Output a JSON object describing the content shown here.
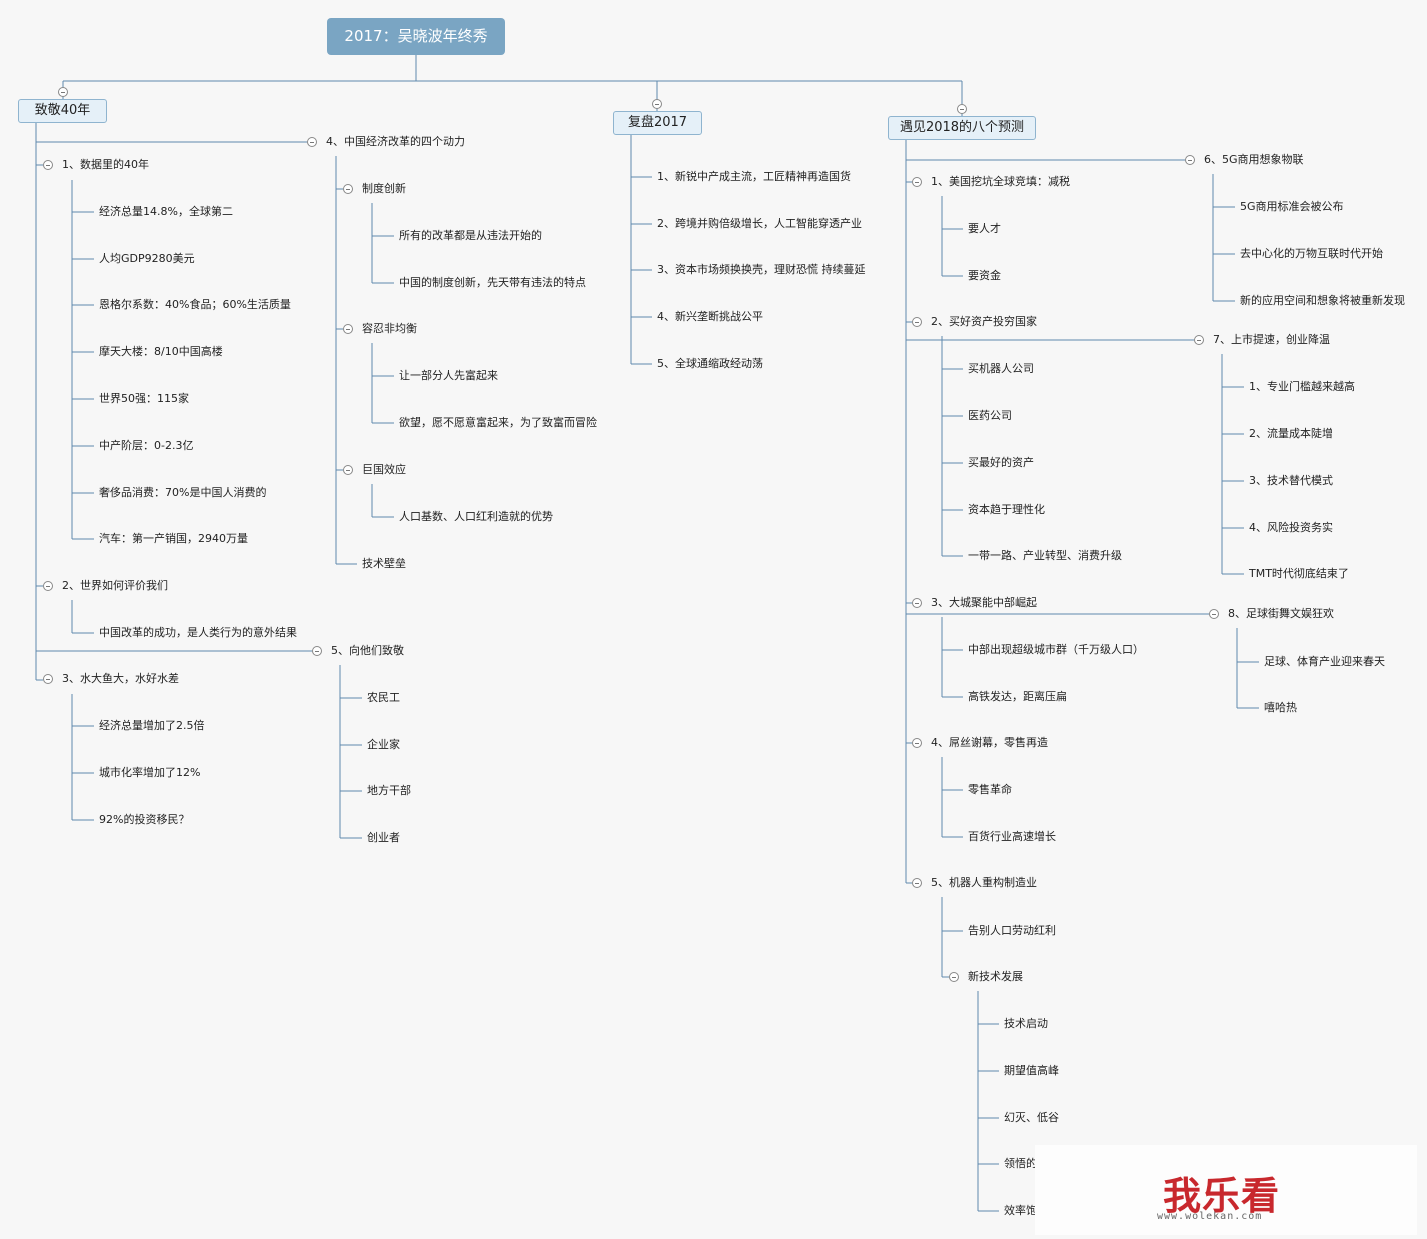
{
  "title": "2017：吴晓波年终秀",
  "branches": {
    "b1": {
      "label": "致敬40年",
      "c1": {
        "label": "1、数据里的40年",
        "items": [
          "经济总量14.8%，全球第二",
          "人均GDP9280美元",
          "恩格尔系数：40%食品；60%生活质量",
          "摩天大楼：8/10中国高楼",
          "世界50强：115家",
          "中产阶层：0-2.3亿",
          "奢侈品消费：70%是中国人消费的",
          "汽车：第一产销国，2940万量"
        ]
      },
      "c2": {
        "label": "2、世界如何评价我们",
        "items": [
          "中国改革的成功，是人类行为的意外结果"
        ]
      },
      "c3": {
        "label": "3、水大鱼大，水好水差",
        "items": [
          "经济总量增加了2.5倍",
          "城市化率增加了12%",
          "92%的投资移民？"
        ]
      },
      "c4": {
        "label": "4、中国经济改革的四个动力",
        "s1": {
          "label": "制度创新",
          "items": [
            "所有的改革都是从违法开始的",
            "中国的制度创新，先天带有违法的特点"
          ]
        },
        "s2": {
          "label": "容忍非均衡",
          "items": [
            "让一部分人先富起来",
            "欲望，愿不愿意富起来，为了致富而冒险"
          ]
        },
        "s3": {
          "label": "巨国效应",
          "items": [
            "人口基数、人口红利造就的优势"
          ]
        },
        "s4": {
          "label": "技术壁垒"
        }
      },
      "c5": {
        "label": "5、向他们致敬",
        "items": [
          "农民工",
          "企业家",
          "地方干部",
          "创业者"
        ]
      }
    },
    "b2": {
      "label": "复盘2017",
      "items": [
        "1、新锐中产成主流，工匠精神再造国货",
        "2、跨境并购倍级增长，人工智能穿透产业",
        "3、资本市场频换换壳，理财恐慌 持续蔓延",
        "4、新兴垄断挑战公平",
        "5、全球通缩政经动荡"
      ]
    },
    "b3": {
      "label": "遇见2018的八个预测",
      "c1": {
        "label": "1、美国挖坑全球竞填：减税",
        "items": [
          "要人才",
          "要资金"
        ]
      },
      "c2": {
        "label": "2、买好资产投穷国家",
        "items": [
          "买机器人公司",
          "医药公司",
          "买最好的资产",
          "资本趋于理性化",
          "一带一路、产业转型、消费升级"
        ]
      },
      "c3": {
        "label": "3、大城聚能中部崛起",
        "items": [
          "中部出现超级城市群（千万级人口）",
          "高铁发达，距离压扁"
        ]
      },
      "c4": {
        "label": "4、屌丝谢幕，零售再造",
        "items": [
          "零售革命",
          "百货行业高速增长"
        ]
      },
      "c5": {
        "label": "5、机器人重构制造业",
        "items": [
          "告别人口劳动红利"
        ],
        "s1": {
          "label": "新技术发展",
          "items": [
            "技术启动",
            "期望值高峰",
            "幻灭、低谷",
            "领悟的",
            "效率饱"
          ]
        }
      },
      "c6": {
        "label": "6、5G商用想象物联",
        "items": [
          "5G商用标准会被公布",
          "去中心化的万物互联时代开始",
          "新的应用空间和想象将被重新发现"
        ]
      },
      "c7": {
        "label": "7、上市提速，创业降温",
        "items": [
          "1、专业门槛越来越高",
          "2、流量成本陡增",
          "3、技术替代模式",
          "4、风险投资务实",
          "TMT时代彻底结束了"
        ]
      },
      "c8": {
        "label": "8、足球街舞文娱狂欢",
        "items": [
          "足球、体育产业迎来春天",
          "嘻哈热"
        ]
      }
    }
  },
  "watermark": {
    "logo": "我乐看",
    "url": "www.wolekan.com"
  },
  "colors": {
    "line": "#5f89ad",
    "root": "#7aa5c3",
    "box_bg": "#e5f0f8",
    "box_border": "#8fb4cf",
    "watermark": "#c8282d"
  }
}
